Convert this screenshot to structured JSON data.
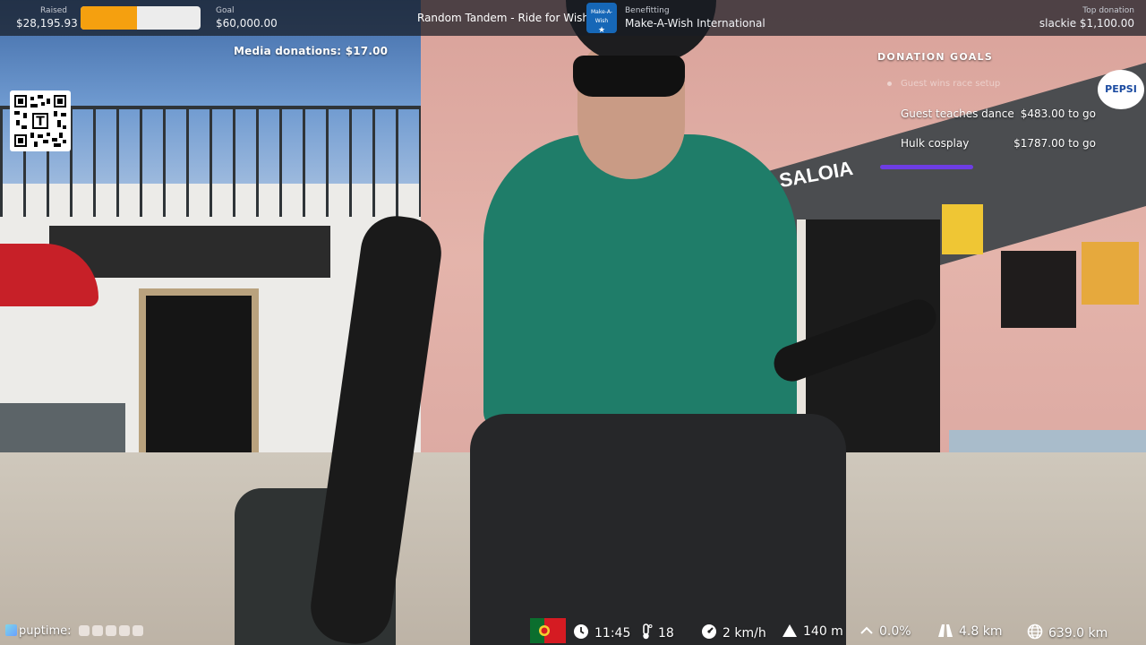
{
  "topbar": {
    "raised_label": "Raised",
    "raised_value": "$28,195.93",
    "raised_progress": 0.47,
    "goal_label": "Goal",
    "goal_value": "$60,000.00",
    "event_title": "Random Tandem - Ride for Wishes",
    "charity_logo_text": "Make-A-Wish",
    "benefitting_label": "Benefitting",
    "charity_name": "Make-A-Wish International",
    "top_donation_label": "Top donation",
    "top_donation_value": "slackie $1,100.00"
  },
  "overlay": {
    "media_donations": "Media donations: $17.00",
    "qr_icon": "qr-code-icon"
  },
  "donation_goals": {
    "title": "DONATION GOALS",
    "completed_goal": "Guest wins race setup",
    "goals": [
      {
        "name": "Guest teaches dance",
        "remaining": "$483.00 to go"
      },
      {
        "name": "Hulk cosplay",
        "remaining": "$1787.00 to go"
      }
    ],
    "bar_color": "#6d3de4"
  },
  "scene_signs": {
    "saloia": "SALOIA",
    "pepsi": "PEPSI"
  },
  "bottombar": {
    "uptime_label": "puptime:",
    "flag": "Portugal",
    "time": "11:45",
    "temperature": "18",
    "speed": "2 km/h",
    "elevation": "140 m",
    "grade": "0.0%",
    "distance_today": "4.8 km",
    "distance_total": "639.0 km"
  },
  "colors": {
    "progress_fill": "#f5a00f",
    "progress_track": "#ececec",
    "topbar_bg": "rgba(24,28,36,0.72)"
  }
}
